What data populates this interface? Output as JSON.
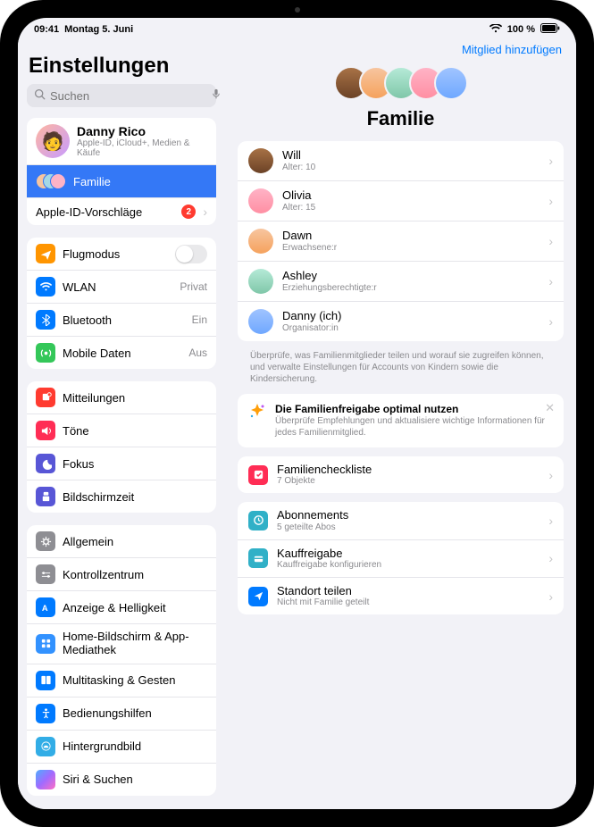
{
  "status": {
    "time": "09:41",
    "date": "Montag 5. Juni",
    "battery": "100 %"
  },
  "sidebar": {
    "title": "Einstellungen",
    "search_placeholder": "Suchen",
    "account": {
      "name": "Danny Rico",
      "sub": "Apple-ID, iCloud+, Medien & Käufe"
    },
    "family_label": "Familie",
    "appleid_suggestions": "Apple-ID-Vorschläge",
    "appleid_badge": "2",
    "airplane": "Flugmodus",
    "wlan": "WLAN",
    "wlan_val": "Privat",
    "bt": "Bluetooth",
    "bt_val": "Ein",
    "cell": "Mobile Daten",
    "cell_val": "Aus",
    "notif": "Mitteilungen",
    "sounds": "Töne",
    "focus": "Fokus",
    "screentime": "Bildschirmzeit",
    "general": "Allgemein",
    "control": "Kontrollzentrum",
    "display": "Anzeige & Helligkeit",
    "home": "Home-Bildschirm & App-Mediathek",
    "multi": "Multitasking & Gesten",
    "access": "Bedienungshilfen",
    "wallpaper": "Hintergrundbild",
    "siri": "Siri & Suchen"
  },
  "main": {
    "add": "Mitglied hinzufügen",
    "title": "Familie",
    "members": [
      {
        "name": "Will",
        "role": "Alter: 10"
      },
      {
        "name": "Olivia",
        "role": "Alter: 15"
      },
      {
        "name": "Dawn",
        "role": "Erwachsene:r"
      },
      {
        "name": "Ashley",
        "role": "Erziehungsberechtigte:r"
      },
      {
        "name": "Danny (ich)",
        "role": "Organisator:in"
      }
    ],
    "footnote": "Überprüfe, was Familienmitglieder teilen und worauf sie zugreifen können, und verwalte Einstellungen für Accounts von Kindern sowie die Kindersicherung.",
    "tip": {
      "title": "Die Familienfreigabe optimal nutzen",
      "desc": "Überprüfe Empfehlungen und aktualisiere wichtige Informationen für jedes Familienmitglied."
    },
    "checklist": {
      "title": "Familiencheckliste",
      "sub": "7 Objekte"
    },
    "subs": {
      "title": "Abonnements",
      "sub": "5 geteilte Abos"
    },
    "purchase": {
      "title": "Kauffreigabe",
      "sub": "Kauffreigabe konfigurieren"
    },
    "location": {
      "title": "Standort teilen",
      "sub": "Nicht mit Familie geteilt"
    }
  }
}
